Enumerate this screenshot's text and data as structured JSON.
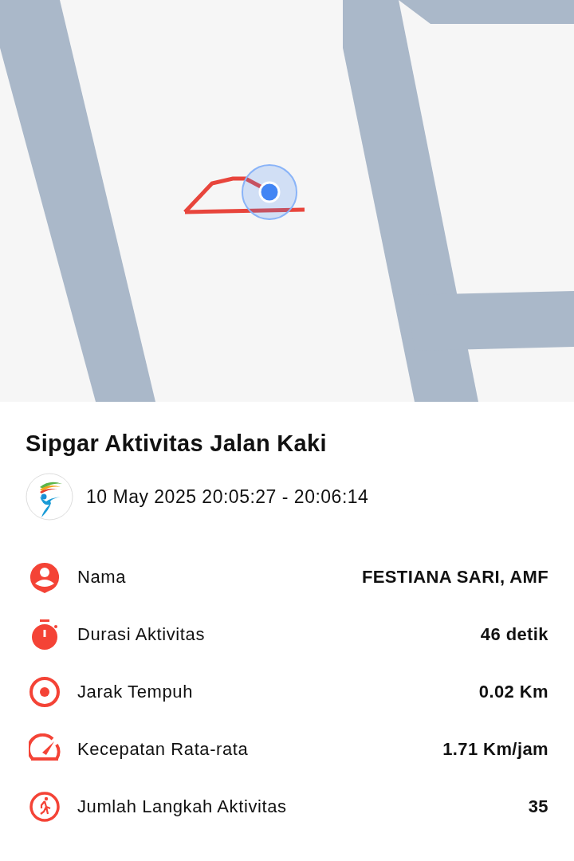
{
  "title": "Sipgar Aktivitas Jalan Kaki",
  "time_range": "10 May 2025 20:05:27 - 20:06:14",
  "stats": [
    {
      "kind": "person",
      "label": "Nama",
      "value": "FESTIANA SARI, AMF"
    },
    {
      "kind": "timer",
      "label": "Durasi Aktivitas",
      "value": "46 detik"
    },
    {
      "kind": "target",
      "label": "Jarak Tempuh",
      "value": "0.02 Km"
    },
    {
      "kind": "speed",
      "label": "Kecepatan Rata-rata",
      "value": "1.71 Km/jam"
    },
    {
      "kind": "walk",
      "label": "Jumlah Langkah Aktivitas",
      "value": "35"
    }
  ]
}
